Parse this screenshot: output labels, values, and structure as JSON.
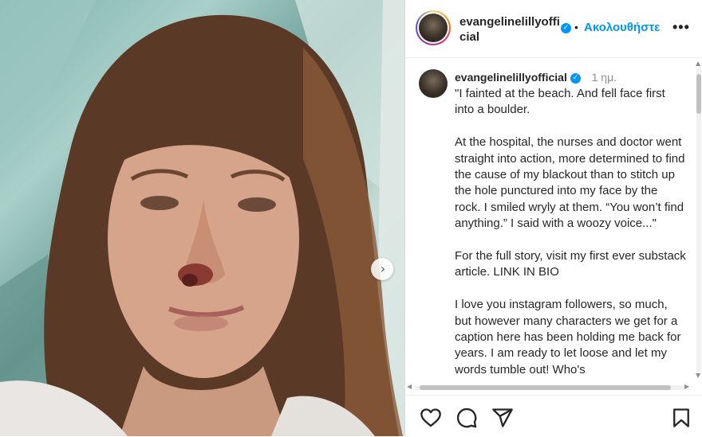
{
  "post": {
    "slide_next_icon": "chevron-right-icon"
  },
  "header": {
    "username": "evangelinelillyofficial",
    "verified_icon": "verified-badge-icon",
    "dot": "•",
    "follow_label": "Ακολουθήστε",
    "more_icon": "more-options-icon"
  },
  "caption": {
    "username": "evangelinelillyofficial",
    "time": "1 ημ.",
    "paragraphs": [
      "\"I fainted at the beach. And fell face first into a boulder.",
      "At the hospital, the nurses and doctor went straight into action, more determined to find the cause of my blackout than to stitch up the hole punctured into my face by the rock. I smiled wryly at them. “You won’t find anything.” I said with a woozy voice...\"",
      "For the full story, visit my first ever substack article. LINK IN BIO",
      "I love you instagram followers, so much, but however many characters we get for a caption here has been holding me back for years. I am ready to let loose and let my words tumble out! Who's"
    ]
  },
  "actions": {
    "like_icon": "heart-icon",
    "comment_icon": "comment-icon",
    "share_icon": "share-icon",
    "save_icon": "bookmark-icon"
  },
  "colors": {
    "accent": "#0095f6",
    "text": "#262626",
    "muted": "#8e8e8e"
  }
}
